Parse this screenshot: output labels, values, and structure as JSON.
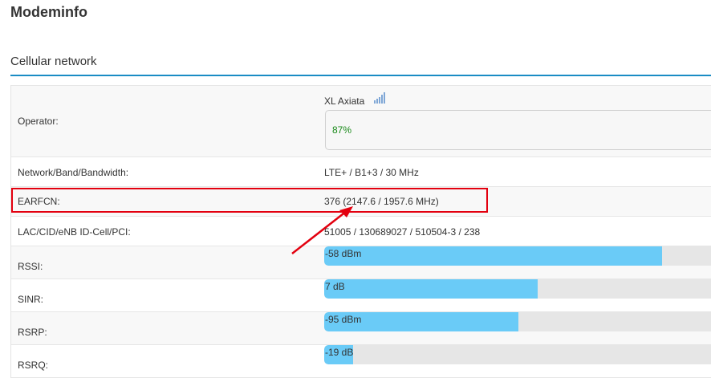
{
  "page": {
    "title": "Modeminfo"
  },
  "section": {
    "title": "Cellular network"
  },
  "rows": {
    "operator": {
      "label": "Operator:",
      "name": "XL Axiata",
      "signal_percent_text": "87%",
      "signal_icon": "signal-bars-icon"
    },
    "network": {
      "label": "Network/Band/Bandwidth:",
      "value": "LTE+ / B1+3 / 30 MHz"
    },
    "earfcn": {
      "label": "EARFCN:",
      "value": "376 (2147.6 / 1957.6 MHz)"
    },
    "lac": {
      "label": "LAC/CID/eNB ID-Cell/PCI:",
      "value": "51005 / 130689027 / 510504-3 / 238"
    },
    "rssi": {
      "label": "RSSI:",
      "value_text": "-58 dBm",
      "level": 0.87
    },
    "sinr": {
      "label": "SINR:",
      "value_text": "7 dB",
      "level": 0.55
    },
    "rsrp": {
      "label": "RSRP:",
      "value_text": "-95 dBm",
      "level": 0.5
    },
    "rsrq": {
      "label": "RSRQ:",
      "value_text": "-19 dB",
      "level": 0.075
    }
  },
  "colors": {
    "accent_rule": "#1a8cc4",
    "meter_fill": "#6acbf7",
    "meter_track": "#e6e6e6",
    "highlight": "#e3000f",
    "percent_text": "#1a8a1a"
  }
}
